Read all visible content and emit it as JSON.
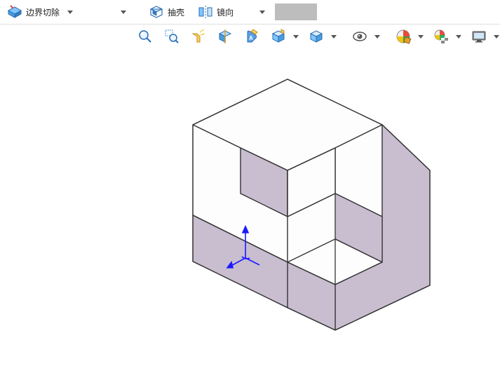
{
  "toolbar1": {
    "boundary_cut": {
      "label": "边界切除",
      "icon": "boundary-cut-icon"
    },
    "shell": {
      "label": "抽壳",
      "icon": "shell-icon"
    },
    "mirror": {
      "label": "镜向",
      "icon": "mirror-icon"
    },
    "swatch_color": "#bdbdbd"
  },
  "toolbar2": {
    "icons": [
      "zoom-fit-icon",
      "zoom-window-icon",
      "flashlight-icon",
      "section-icon",
      "measure-icon",
      "box-shade-icon",
      "box-wire-icon",
      "visibility-icon",
      "appearance-icon",
      "scene-icon",
      "display-icon"
    ]
  },
  "model": {
    "description": "Isometric L-shaped block with rectangular cutout",
    "face_light": "#fdfdfd",
    "face_shade": "#c9bdd0",
    "edge": "#333333",
    "origin_axis_color": "#1a1aff"
  }
}
